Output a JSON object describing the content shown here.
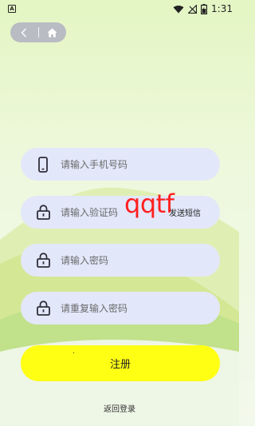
{
  "status_bar": {
    "app_icon_letter": "A",
    "time": "1:31"
  },
  "nav": {
    "back_icon": "chevron-left-icon",
    "home_icon": "home-icon"
  },
  "form": {
    "phone": {
      "placeholder": "请输入手机号码",
      "value": "",
      "icon": "phone-icon"
    },
    "code": {
      "placeholder": "请输入验证码",
      "value": "",
      "icon": "lock-icon",
      "send_sms_label": "发送短信"
    },
    "password": {
      "placeholder": "请输入密码",
      "value": "",
      "icon": "lock-icon"
    },
    "confirm_password": {
      "placeholder": "请重复输入密码",
      "value": "",
      "icon": "lock-icon"
    }
  },
  "overlay_text": "qqtf",
  "register_label": "注册",
  "back_login_label": "返回登录",
  "colors": {
    "field_bg": "#e3e7fa",
    "button_bg": "#ffff14",
    "overlay_text": "#ff1f1f",
    "nav_pill": "#b9bcc3"
  }
}
